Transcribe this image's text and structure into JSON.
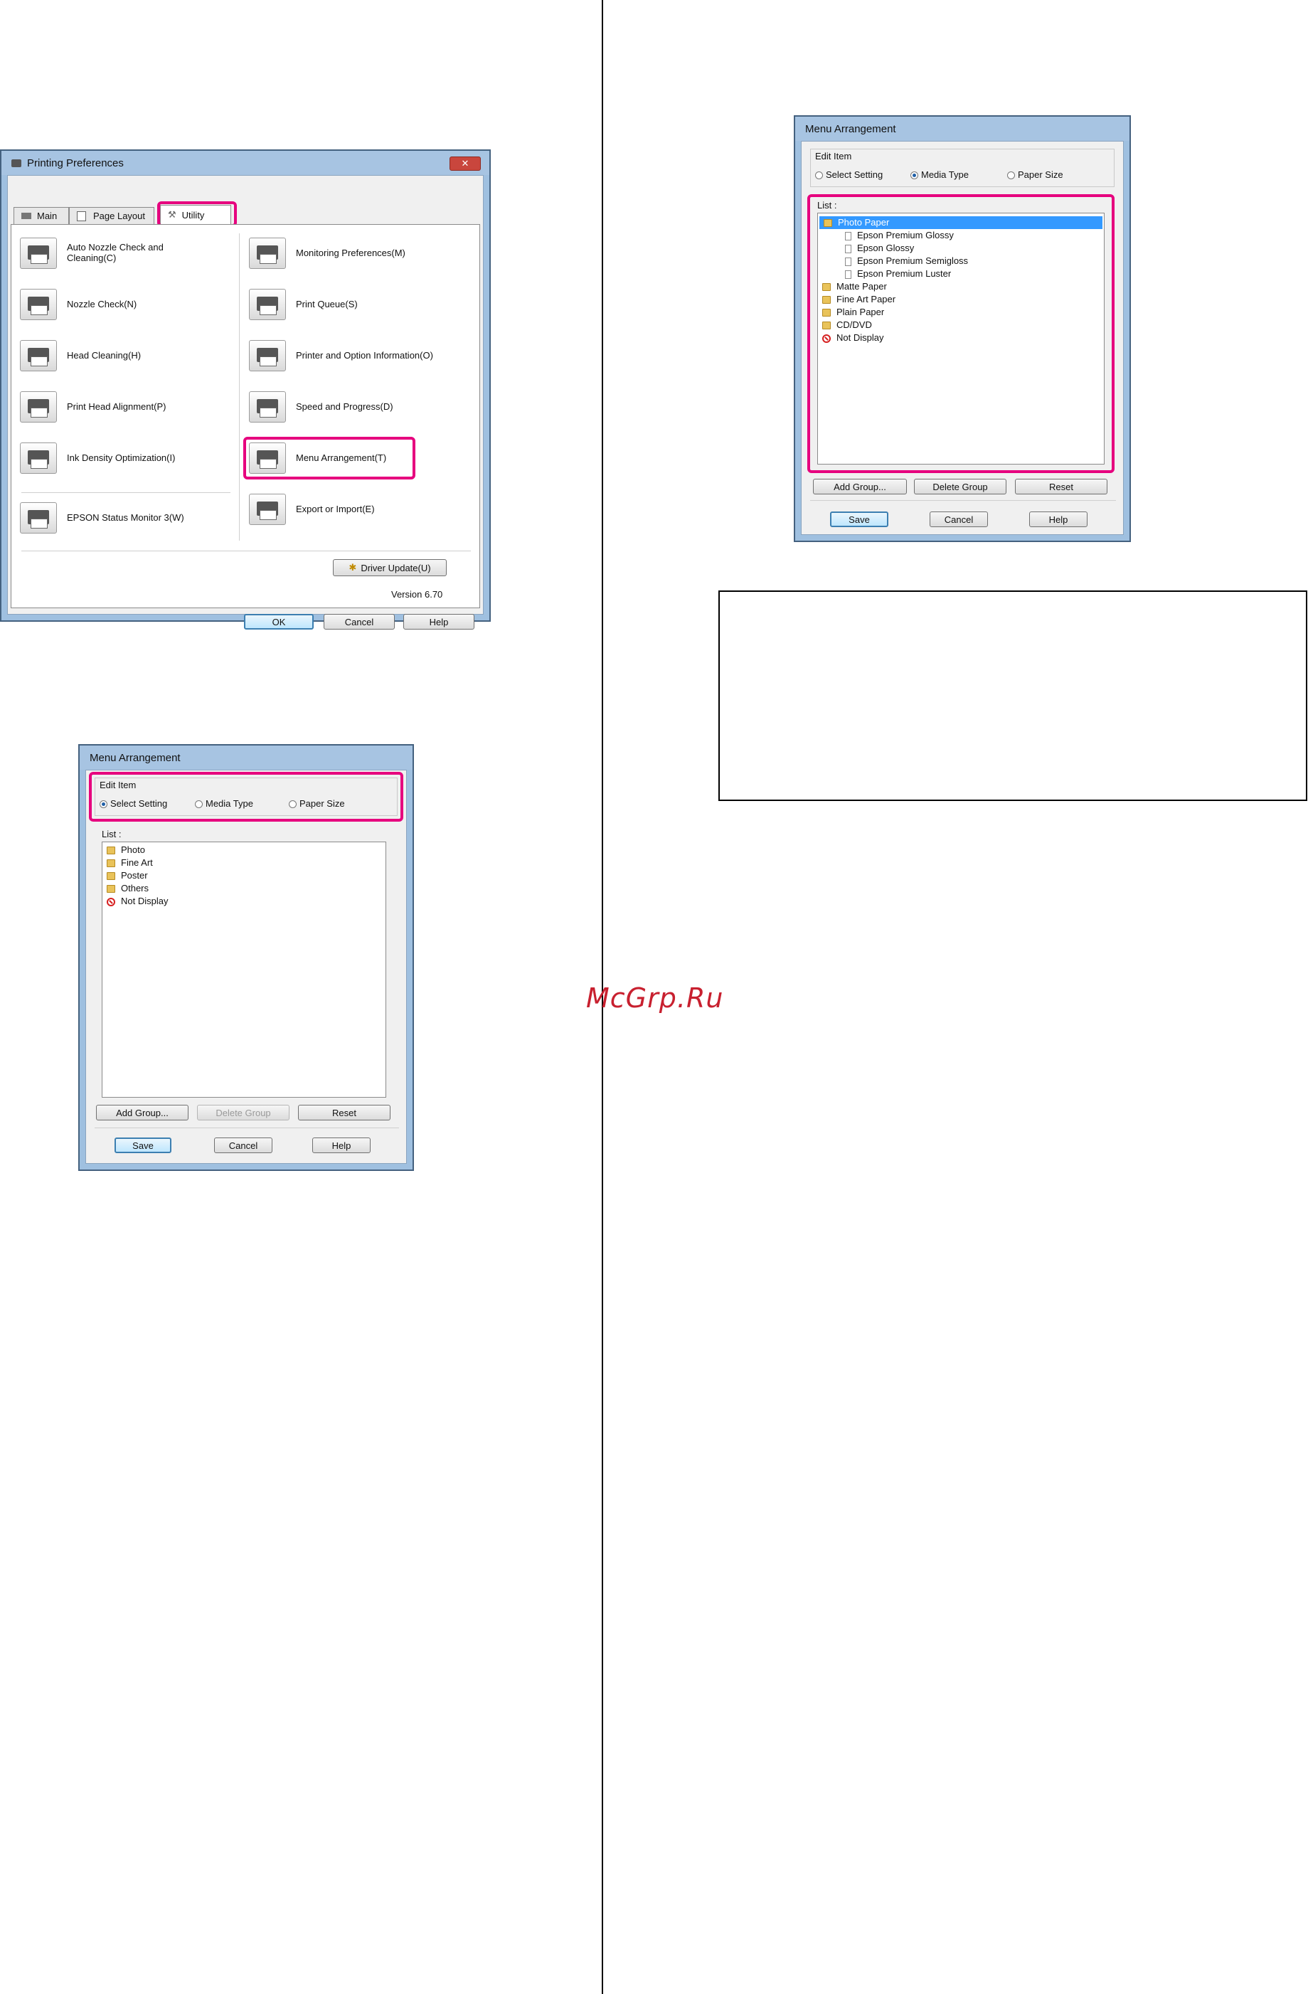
{
  "printing_preferences": {
    "title": "Printing Preferences",
    "tabs": [
      "Main",
      "Page Layout",
      "Utility"
    ],
    "left_items": [
      "Auto Nozzle Check and Cleaning(C)",
      "Nozzle Check(N)",
      "Head Cleaning(H)",
      "Print Head Alignment(P)",
      "Ink Density Optimization(I)",
      "EPSON Status Monitor 3(W)"
    ],
    "right_items": [
      "Monitoring Preferences(M)",
      "Print Queue(S)",
      "Printer and Option Information(O)",
      "Speed and Progress(D)",
      "Menu Arrangement(T)",
      "Export or Import(E)"
    ],
    "driver_update": "Driver Update(U)",
    "version": "Version 6.70",
    "ok": "OK",
    "cancel": "Cancel",
    "help": "Help"
  },
  "menu_arrangement_1": {
    "title": "Menu Arrangement",
    "edit_item_label": "Edit Item",
    "radio_options": [
      "Select Setting",
      "Media Type",
      "Paper Size"
    ],
    "selected_option": "Select Setting",
    "list_label": "List :",
    "list_items": [
      "Photo",
      "Fine Art",
      "Poster",
      "Others",
      "Not Display"
    ],
    "add_group": "Add Group...",
    "delete_group": "Delete Group",
    "reset": "Reset",
    "save": "Save",
    "cancel": "Cancel",
    "help": "Help"
  },
  "menu_arrangement_2": {
    "title": "Menu Arrangement",
    "edit_item_label": "Edit Item",
    "radio_options": [
      "Select Setting",
      "Media Type",
      "Paper Size"
    ],
    "selected_option": "Media Type",
    "list_label": "List :",
    "list_items": [
      "Photo Paper",
      "Epson Premium Glossy",
      "Epson Glossy",
      "Epson Premium Semigloss",
      "Epson Premium Luster",
      "Matte Paper",
      "Fine Art Paper",
      "Plain Paper",
      "CD/DVD",
      "Not Display"
    ],
    "add_group": "Add Group...",
    "delete_group": "Delete Group",
    "reset": "Reset",
    "save": "Save",
    "cancel": "Cancel",
    "help": "Help"
  },
  "watermark": "McGrp.Ru"
}
